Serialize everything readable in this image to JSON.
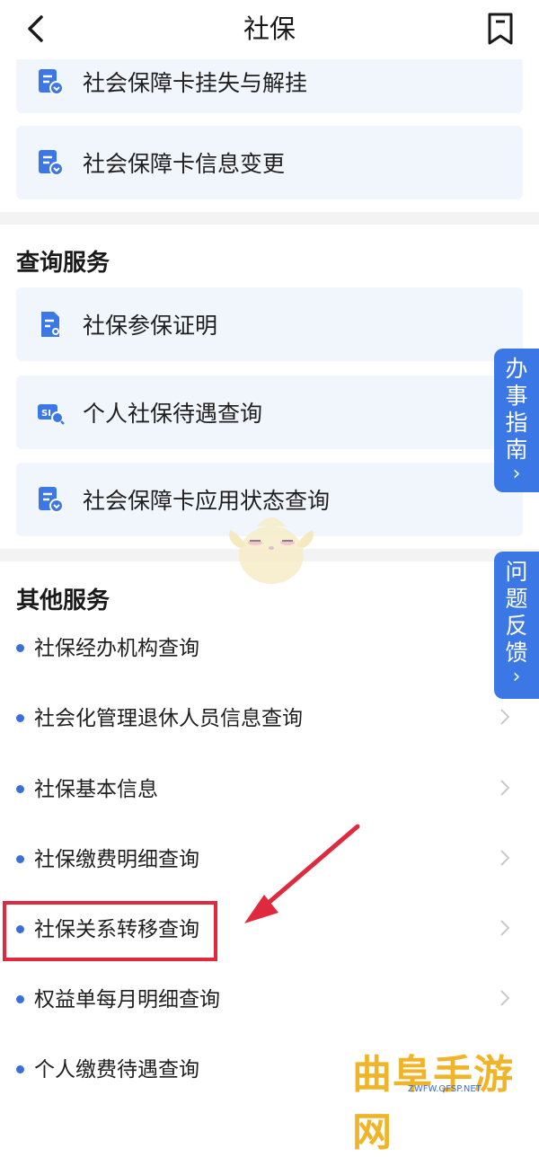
{
  "header": {
    "title": "社保"
  },
  "cards_top": [
    {
      "label": "社会保障卡挂失与解挂"
    },
    {
      "label": "社会保障卡信息变更"
    }
  ],
  "query_section": {
    "title": "查询服务",
    "items": [
      {
        "label": "社保参保证明"
      },
      {
        "label": "个人社保待遇查询"
      },
      {
        "label": "社会保障卡应用状态查询"
      }
    ]
  },
  "other_section": {
    "title": "其他服务",
    "items": [
      {
        "label": "社保经办机构查询"
      },
      {
        "label": "社会化管理退休人员信息查询"
      },
      {
        "label": "社保基本信息"
      },
      {
        "label": "社保缴费明细查询"
      },
      {
        "label": "社保关系转移查询"
      },
      {
        "label": "权益单每月明细查询"
      },
      {
        "label": "个人缴费待遇查询"
      }
    ]
  },
  "side_tabs": {
    "guide": "办事指南",
    "feedback": "问题反馈",
    "arrow": "›"
  },
  "watermark": {
    "text": "曲阜手游网",
    "url": "ZWFW.QFSP.NET"
  },
  "colors": {
    "accent": "#3c77e6",
    "card_bg": "#f1f5fc",
    "highlight": "#e0283f",
    "watermark": "#f0b428"
  }
}
